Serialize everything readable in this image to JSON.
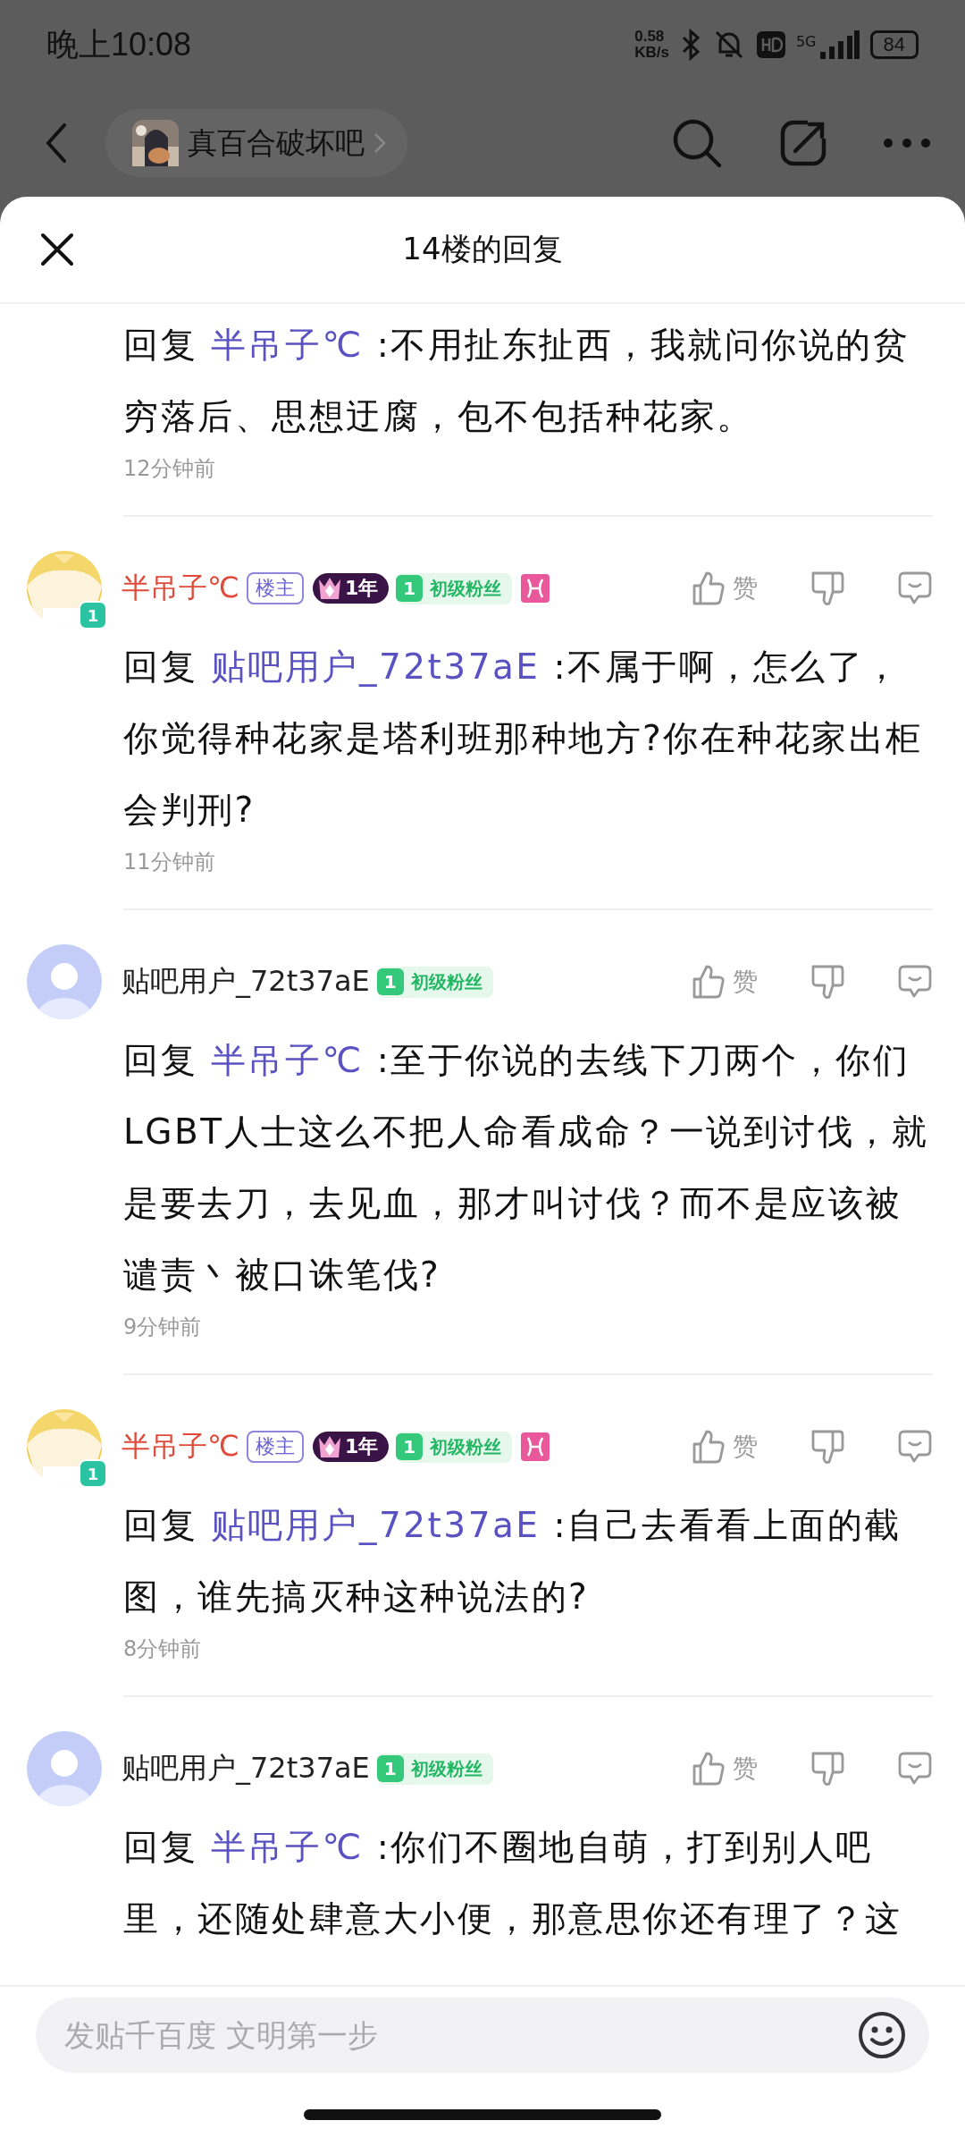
{
  "status_bar": {
    "time": "晚上10:08",
    "net_speed_value": "0.58",
    "net_speed_unit": "KB/s",
    "network": "5G",
    "battery": "84"
  },
  "nav": {
    "forum": "真百合破坏吧"
  },
  "sheet": {
    "title": "14楼的回复"
  },
  "replies": [
    {
      "kind": "continued",
      "reply_label": "回复",
      "reply_to": "半吊子℃",
      "text": ":不用扯东扯西，我就问你说的贫穷落后、思想迂腐，包不包括种花家。",
      "time": "12分钟前"
    },
    {
      "kind": "full",
      "user": {
        "name": "半吊子℃",
        "avatar_level": "1",
        "is_op": true,
        "op_label": "楼主",
        "year_badge": "1年",
        "fan_level": "1",
        "fan_title": "初级粉丝",
        "zodiac": true
      },
      "like_label": "赞",
      "reply_label": "回复",
      "reply_to": "贴吧用户_72t37aE",
      "text": ":不属于啊，怎么了，你觉得种花家是塔利班那种地方?你在种花家出柜会判刑?",
      "time": "11分钟前"
    },
    {
      "kind": "full",
      "user": {
        "name": "贴吧用户_72t37aE",
        "avatar": {
          "kind": "default"
        },
        "is_op": false,
        "fan_level": "1",
        "fan_title": "初级粉丝",
        "zodiac": false
      },
      "like_label": "赞",
      "reply_label": "回复",
      "reply_to": "半吊子℃",
      "text": ":至于你说的去线下刀两个，你们LGBT人士这么不把人命看成命？一说到讨伐，就是要去刀，去见血，那才叫讨伐？而不是应该被谴责丶被口诛笔伐?",
      "time": "9分钟前"
    },
    {
      "kind": "full",
      "user": {
        "name": "半吊子℃",
        "avatar_level": "1",
        "is_op": true,
        "op_label": "楼主",
        "year_badge": "1年",
        "fan_level": "1",
        "fan_title": "初级粉丝",
        "zodiac": true
      },
      "like_label": "赞",
      "reply_label": "回复",
      "reply_to": "贴吧用户_72t37aE",
      "text": ":自己去看看上面的截图，谁先搞灭种这种说法的?",
      "time": "8分钟前"
    },
    {
      "kind": "full",
      "user": {
        "name": "贴吧用户_72t37aE",
        "avatar": {
          "kind": "default"
        },
        "is_op": false,
        "fan_level": "1",
        "fan_title": "初级粉丝",
        "zodiac": false
      },
      "like_label": "赞",
      "reply_label": "回复",
      "reply_to": "半吊子℃",
      "text": ":你们不圈地自萌，打到别人吧里，还随处肆意大小便，那意思你还有理了？这"
    }
  ],
  "input": {
    "placeholder": "发贴千百度 文明第一步"
  }
}
